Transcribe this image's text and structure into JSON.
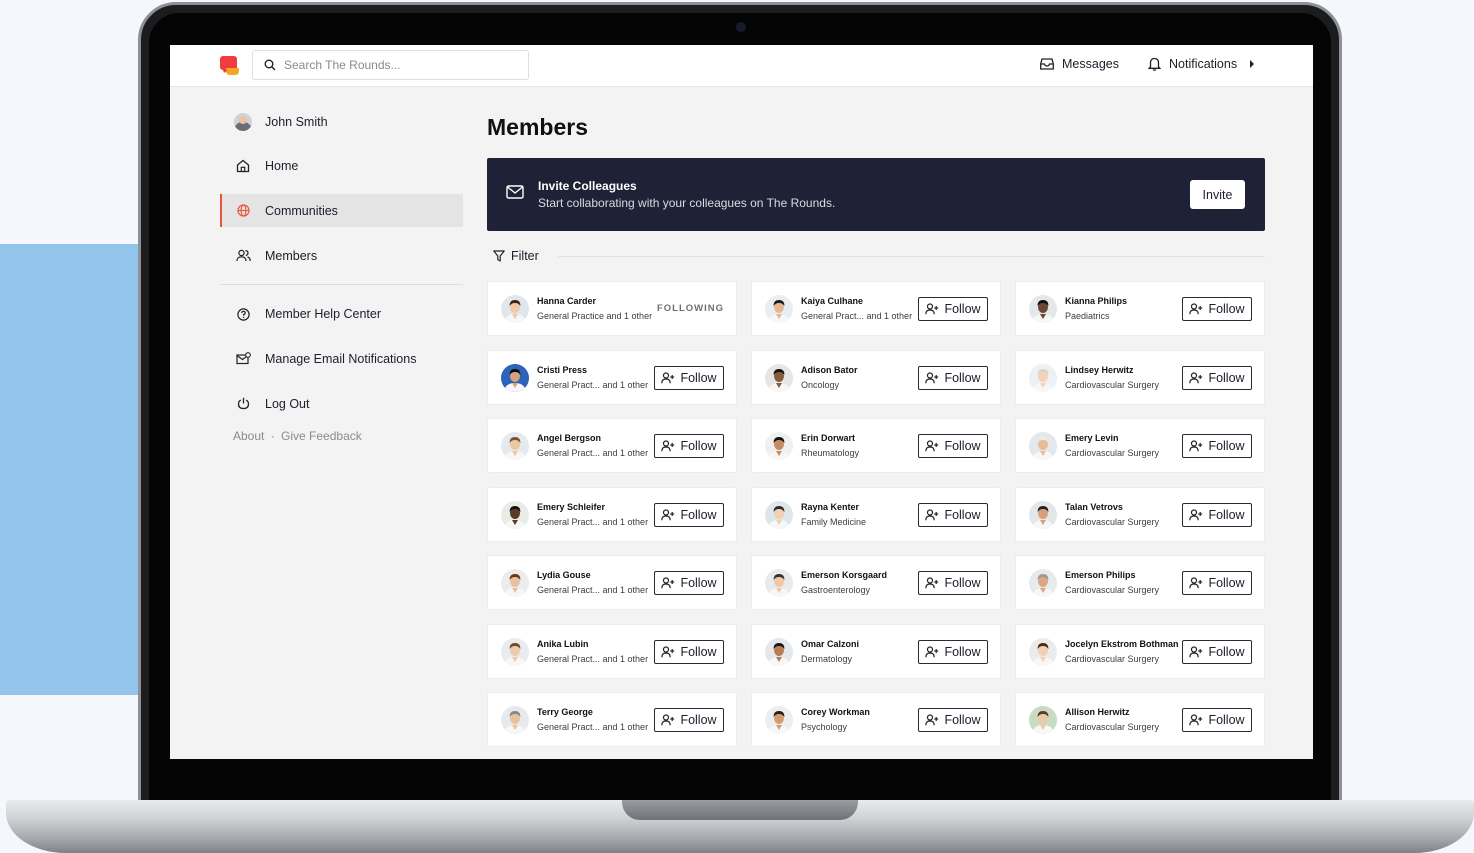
{
  "header": {
    "search_placeholder": "Search The Rounds...",
    "messages_label": "Messages",
    "notifications_label": "Notifications"
  },
  "sidebar": {
    "items": [
      {
        "label": "John Smith",
        "icon": "avatar"
      },
      {
        "label": "Home",
        "icon": "home-icon"
      },
      {
        "label": "Communities",
        "icon": "globe-icon",
        "active": true
      },
      {
        "label": "Members",
        "icon": "users-icon"
      }
    ],
    "secondary": [
      {
        "label": "Member Help Center",
        "icon": "help-icon"
      },
      {
        "label": "Manage Email Notifications",
        "icon": "email-settings-icon"
      },
      {
        "label": "Log Out",
        "icon": "power-icon"
      }
    ],
    "footer": {
      "about": "About",
      "separator": "·",
      "feedback": "Give Feedback"
    }
  },
  "main": {
    "title": "Members",
    "invite": {
      "title": "Invite Colleagues",
      "subtitle": "Start collaborating with your colleagues on The Rounds.",
      "button": "Invite"
    },
    "filter_label": "Filter",
    "follow_label": "Follow",
    "following_label": "FOLLOWING",
    "members": [
      {
        "name": "Hanna Carder",
        "specialty": "General Practice and 1 other",
        "following": true
      },
      {
        "name": "Kaiya Culhane",
        "specialty": "General Pract... and 1 other",
        "following": false
      },
      {
        "name": "Kianna Philips",
        "specialty": "Paediatrics",
        "following": false
      },
      {
        "name": "Cristi Press",
        "specialty": "General Pract... and 1 other",
        "following": false
      },
      {
        "name": "Adison Bator",
        "specialty": "Oncology",
        "following": false
      },
      {
        "name": "Lindsey Herwitz",
        "specialty": "Cardiovascular Surgery",
        "following": false
      },
      {
        "name": "Angel Bergson",
        "specialty": "General Pract... and 1 other",
        "following": false
      },
      {
        "name": "Erin Dorwart",
        "specialty": "Rheumatology",
        "following": false
      },
      {
        "name": "Emery Levin",
        "specialty": "Cardiovascular Surgery",
        "following": false
      },
      {
        "name": "Emery Schleifer",
        "specialty": "General Pract... and 1 other",
        "following": false
      },
      {
        "name": "Rayna Kenter",
        "specialty": "Family Medicine",
        "following": false
      },
      {
        "name": "Talan Vetrovs",
        "specialty": "Cardiovascular Surgery",
        "following": false
      },
      {
        "name": "Lydia Gouse",
        "specialty": "General Pract... and 1 other",
        "following": false
      },
      {
        "name": "Emerson Korsgaard",
        "specialty": "Gastroenterology",
        "following": false
      },
      {
        "name": "Emerson Philips",
        "specialty": "Cardiovascular Surgery",
        "following": false
      },
      {
        "name": "Anika Lubin",
        "specialty": "General Pract... and 1 other",
        "following": false
      },
      {
        "name": "Omar Calzoni",
        "specialty": "Dermatology",
        "following": false
      },
      {
        "name": "Jocelyn Ekstrom Bothman",
        "specialty": "Cardiovascular Surgery",
        "following": false
      },
      {
        "name": "Terry George",
        "specialty": "General Pract... and 1 other",
        "following": false
      },
      {
        "name": "Corey Workman",
        "specialty": "Psychology",
        "following": false
      },
      {
        "name": "Allison Herwitz",
        "specialty": "Cardiovascular Surgery",
        "following": false
      }
    ]
  },
  "colors": {
    "accent": "#e8553a",
    "invite_banner": "#1f2236",
    "side_panel_blue": "#92c5e9"
  }
}
